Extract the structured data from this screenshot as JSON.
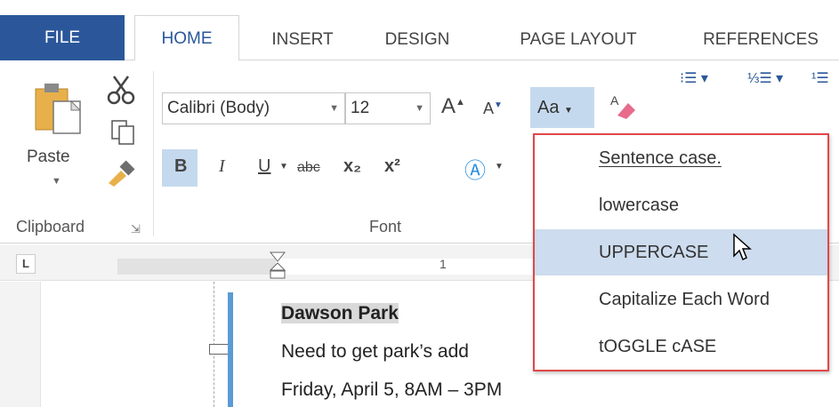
{
  "tabs": {
    "file": "FILE",
    "home": "HOME",
    "insert": "INSERT",
    "design": "DESIGN",
    "page_layout": "PAGE LAYOUT",
    "references": "REFERENCES"
  },
  "clipboard": {
    "paste_label": "Paste",
    "group_label": "Clipboard"
  },
  "font": {
    "family": "Calibri (Body)",
    "size": "12",
    "change_case_label": "Aa",
    "group_label": "Font",
    "bold": "B",
    "italic": "I",
    "underline": "U",
    "strikethrough": "abc",
    "subscript": "x₂",
    "superscript": "x²"
  },
  "ruler": {
    "tab_marker": "L",
    "mark_1": "1"
  },
  "document": {
    "line1": "Dawson Park",
    "line2": "Need to get park’s add",
    "line3": "Friday,  April 5, 8AM – 3PM"
  },
  "change_case_menu": {
    "items": [
      {
        "label": "Sentence case."
      },
      {
        "label": "lowercase"
      },
      {
        "label": "UPPERCASE"
      },
      {
        "label": "Capitalize Each Word"
      },
      {
        "label": "tOGGLE cASE"
      }
    ],
    "hovered": "UPPERCASE"
  }
}
